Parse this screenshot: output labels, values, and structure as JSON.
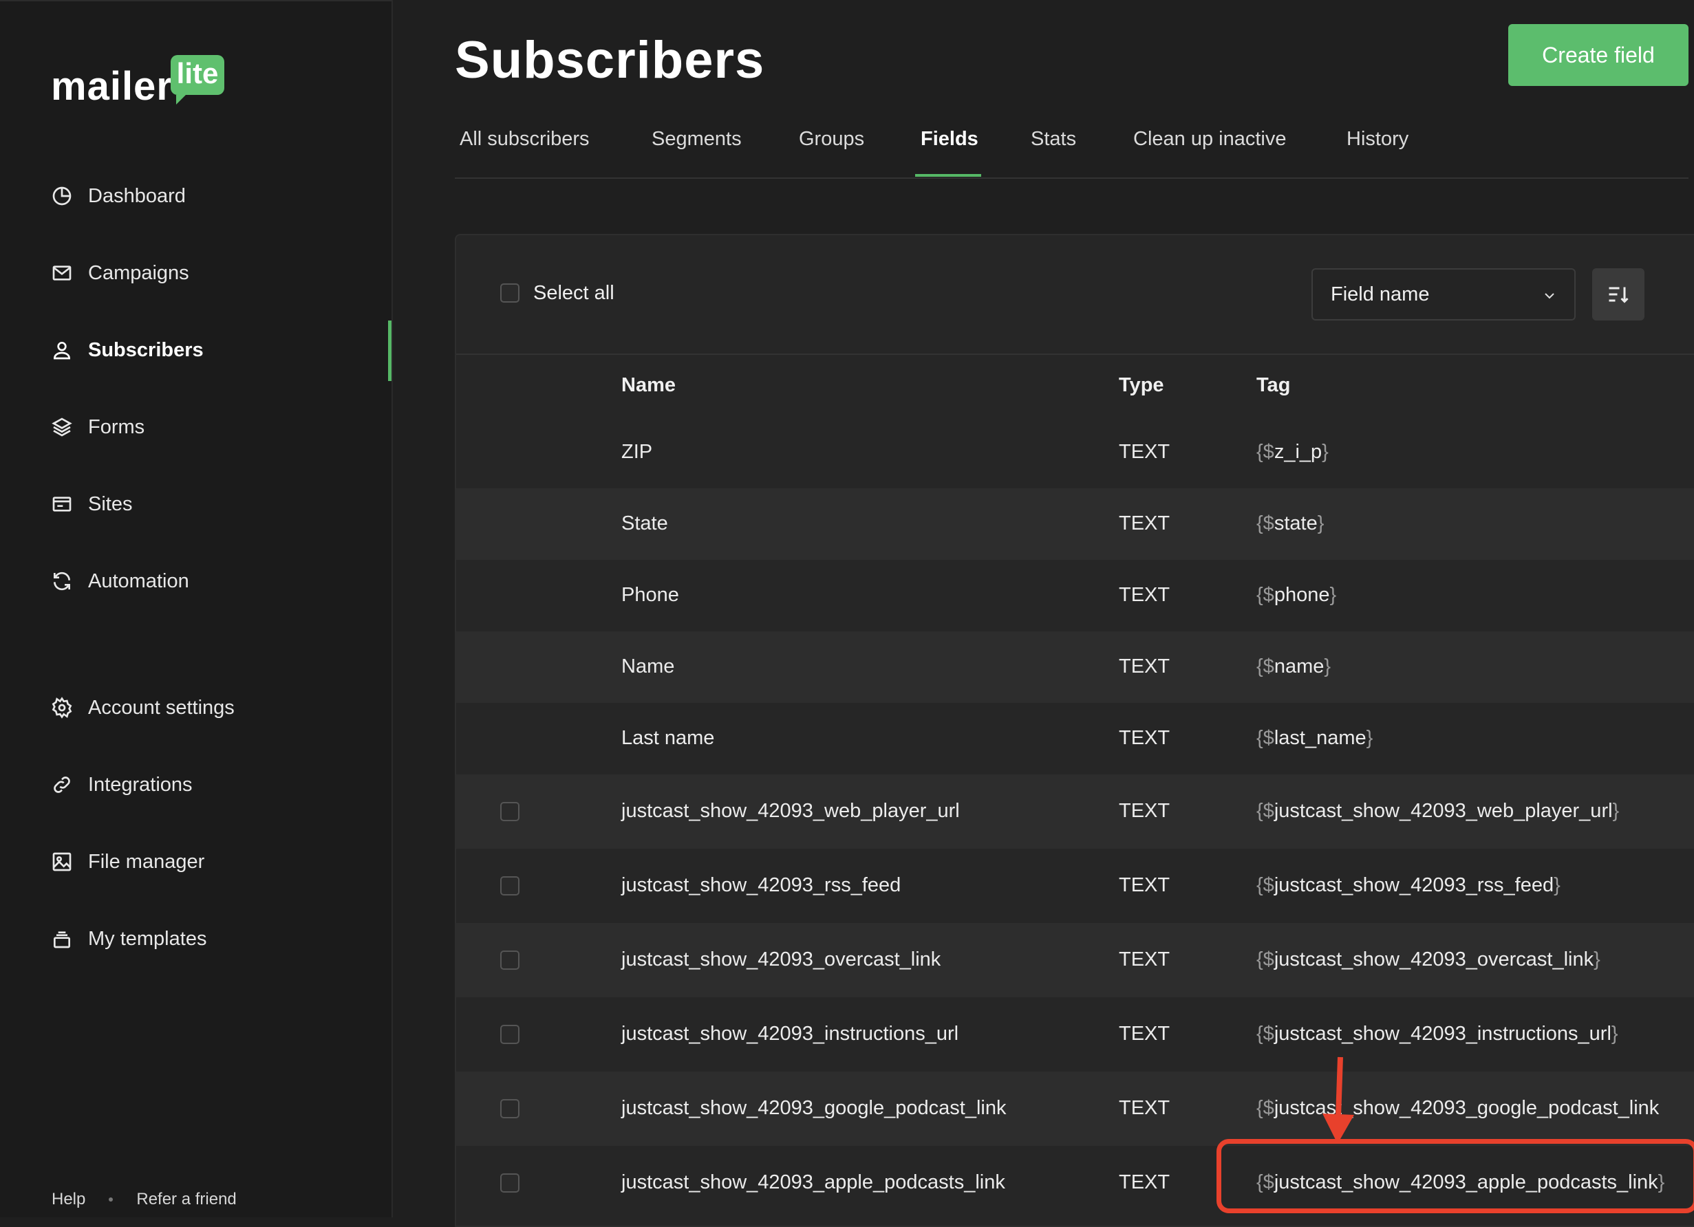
{
  "brand": {
    "word": "mailer",
    "badge": "lite"
  },
  "sidebar": {
    "items": [
      {
        "label": "Dashboard",
        "icon": "pie-chart-icon"
      },
      {
        "label": "Campaigns",
        "icon": "envelope-icon"
      },
      {
        "label": "Subscribers",
        "icon": "user-icon",
        "active": true
      },
      {
        "label": "Forms",
        "icon": "layers-icon"
      },
      {
        "label": "Sites",
        "icon": "browser-icon"
      },
      {
        "label": "Automation",
        "icon": "refresh-icon"
      },
      {
        "label": "Account settings",
        "icon": "gear-icon"
      },
      {
        "label": "Integrations",
        "icon": "link-icon"
      },
      {
        "label": "File manager",
        "icon": "image-icon"
      },
      {
        "label": "My templates",
        "icon": "stack-icon"
      }
    ],
    "footer": {
      "help": "Help",
      "refer": "Refer a friend"
    }
  },
  "header": {
    "title": "Subscribers",
    "create_button": "Create field"
  },
  "tabs": [
    {
      "label": "All subscribers"
    },
    {
      "label": "Segments"
    },
    {
      "label": "Groups"
    },
    {
      "label": "Fields",
      "active": true
    },
    {
      "label": "Stats"
    },
    {
      "label": "Clean up inactive"
    },
    {
      "label": "History"
    }
  ],
  "toolbar": {
    "select_all": "Select all",
    "sort_field": "Field name"
  },
  "table": {
    "columns": [
      "Name",
      "Type",
      "Tag"
    ],
    "rows": [
      {
        "name": "ZIP",
        "type": "TEXT",
        "tag_open": "{$",
        "tag": "z_i_p",
        "tag_close": "}",
        "selectable": false
      },
      {
        "name": "State",
        "type": "TEXT",
        "tag_open": "{$",
        "tag": "state",
        "tag_close": "}",
        "selectable": false
      },
      {
        "name": "Phone",
        "type": "TEXT",
        "tag_open": "{$",
        "tag": "phone",
        "tag_close": "}",
        "selectable": false
      },
      {
        "name": "Name",
        "type": "TEXT",
        "tag_open": "{$",
        "tag": "name",
        "tag_close": "}",
        "selectable": false
      },
      {
        "name": "Last name",
        "type": "TEXT",
        "tag_open": "{$",
        "tag": "last_name",
        "tag_close": "}",
        "selectable": false
      },
      {
        "name": "justcast_show_42093_web_player_url",
        "type": "TEXT",
        "tag_open": "{$",
        "tag": "justcast_show_42093_web_player_url",
        "tag_close": "}",
        "selectable": true
      },
      {
        "name": "justcast_show_42093_rss_feed",
        "type": "TEXT",
        "tag_open": "{$",
        "tag": "justcast_show_42093_rss_feed",
        "tag_close": "}",
        "selectable": true
      },
      {
        "name": "justcast_show_42093_overcast_link",
        "type": "TEXT",
        "tag_open": "{$",
        "tag": "justcast_show_42093_overcast_link",
        "tag_close": "}",
        "selectable": true
      },
      {
        "name": "justcast_show_42093_instructions_url",
        "type": "TEXT",
        "tag_open": "{$",
        "tag": "justcast_show_42093_instructions_url",
        "tag_close": "}",
        "selectable": true
      },
      {
        "name": "justcast_show_42093_google_podcast_link",
        "type": "TEXT",
        "tag_open": "{$",
        "tag": "justcast_show_42093_google_podcast_link",
        "tag_close": "",
        "selectable": true
      },
      {
        "name": "justcast_show_42093_apple_podcasts_link",
        "type": "TEXT",
        "tag_open": "{$",
        "tag": "justcast_show_42093_apple_podcasts_link",
        "tag_close": "}",
        "selectable": true
      }
    ]
  },
  "colors": {
    "accent": "#5cbd6d",
    "annotation": "#e8412c"
  }
}
